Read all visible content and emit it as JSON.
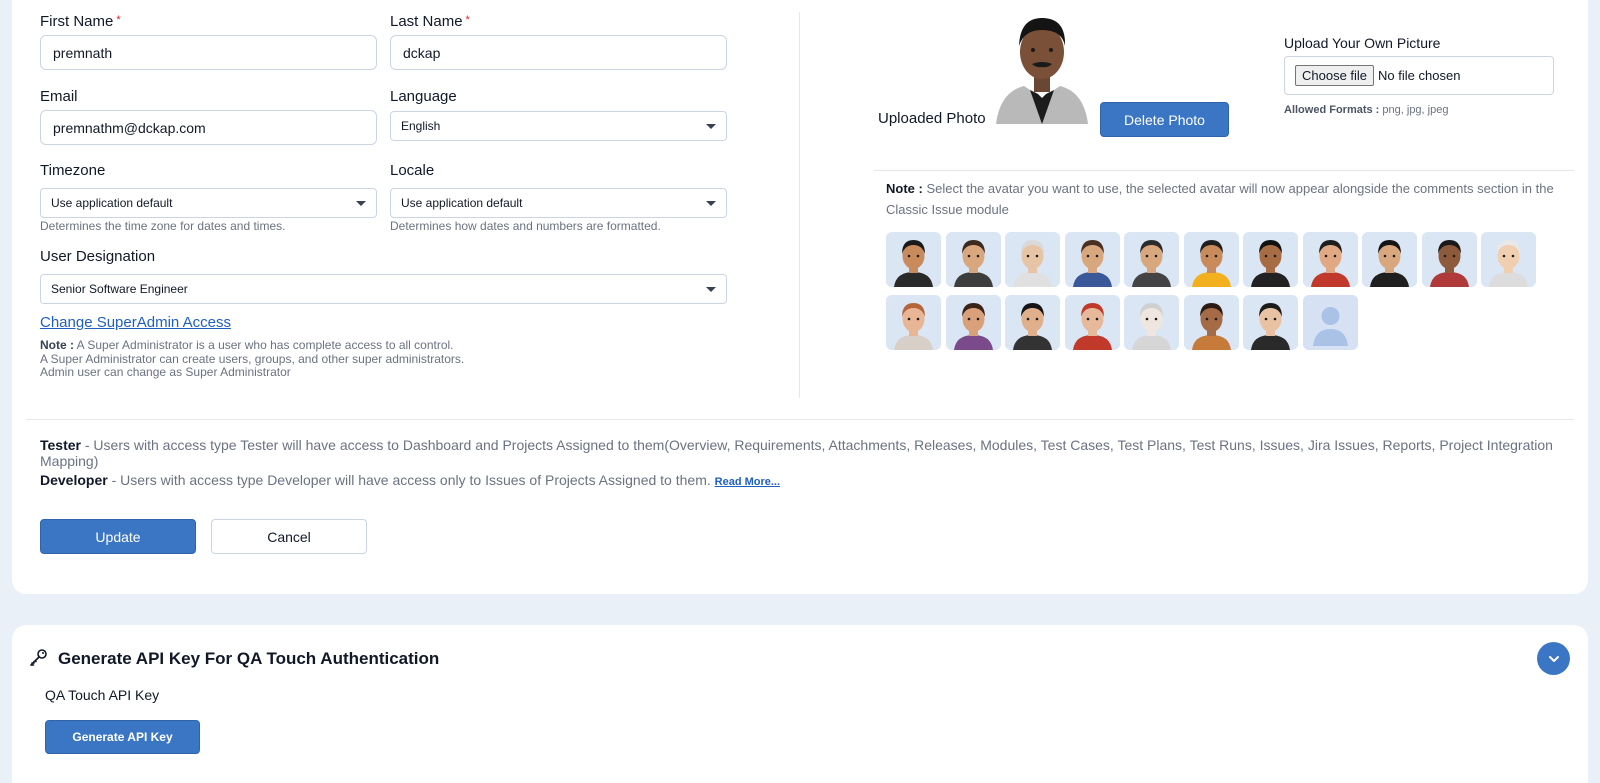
{
  "form": {
    "first_name": {
      "label": "First Name",
      "required": "*",
      "value": "premnath"
    },
    "last_name": {
      "label": "Last Name",
      "required": "*",
      "value": "dckap"
    },
    "email": {
      "label": "Email",
      "value": "premnathm@dckap.com"
    },
    "language": {
      "label": "Language",
      "value": "English"
    },
    "timezone": {
      "label": "Timezone",
      "value": "Use application default",
      "help": "Determines the time zone for dates and times."
    },
    "locale": {
      "label": "Locale",
      "value": "Use application default",
      "help": "Determines how dates and numbers are formatted."
    },
    "designation": {
      "label": "User Designation",
      "value": "Senior Software Engineer"
    }
  },
  "superadmin": {
    "link": "Change SuperAdmin Access",
    "note_label": "Note :",
    "note_lines": [
      "A Super Administrator is a user who has complete access to all control.",
      "A Super Administrator can create users, groups, and other super administrators.",
      "Admin user can change as Super Administrator"
    ]
  },
  "photo": {
    "uploaded_label": "Uploaded Photo",
    "delete_button": "Delete Photo",
    "upload_title": "Upload Your Own Picture",
    "choose_file": "Choose file",
    "no_file": "No file chosen",
    "formats_label": "Allowed Formats :",
    "formats": "png, jpg, jpeg"
  },
  "avatar_note": {
    "label": "Note :",
    "text": "Select the avatar you want to use, the selected avatar will now appear alongside the comments section in the",
    "text2": "Classic Issue module"
  },
  "avatars": [
    {
      "name": "avatar-1",
      "skin": "#c98b5c",
      "hair": "#1a1a1a",
      "shirt": "#2a2a2a"
    },
    {
      "name": "avatar-2",
      "skin": "#d9a77e",
      "hair": "#3b2a1e",
      "shirt": "#3d3d3d"
    },
    {
      "name": "avatar-3",
      "skin": "#e6c4a5",
      "hair": "#d9d9d9",
      "shirt": "#e0e0e0"
    },
    {
      "name": "avatar-4",
      "skin": "#d9a77e",
      "hair": "#4a3020",
      "shirt": "#3b5998"
    },
    {
      "name": "avatar-5",
      "skin": "#d9a77e",
      "hair": "#2b2b2b",
      "shirt": "#444444"
    },
    {
      "name": "avatar-6",
      "skin": "#c98b5c",
      "hair": "#1f1f1f",
      "shirt": "#f2b01e"
    },
    {
      "name": "avatar-7",
      "skin": "#a86c45",
      "hair": "#111111",
      "shirt": "#222222"
    },
    {
      "name": "avatar-8",
      "skin": "#e0a983",
      "hair": "#1e1e1e",
      "shirt": "#c0392b"
    },
    {
      "name": "avatar-9",
      "skin": "#d9a77e",
      "hair": "#151515",
      "shirt": "#1f1f1f"
    },
    {
      "name": "avatar-10",
      "skin": "#8d5a3b",
      "hair": "#1a1a1a",
      "shirt": "#b03a3a"
    },
    {
      "name": "avatar-11",
      "skin": "#f0cfb0",
      "hair": "#e8e8e8",
      "shirt": "#dcdcdc"
    },
    {
      "name": "avatar-12",
      "skin": "#e8b695",
      "hair": "#b5653a",
      "shirt": "#d8d0c8"
    },
    {
      "name": "avatar-13",
      "skin": "#d9a07a",
      "hair": "#3a2418",
      "shirt": "#7a4a8a"
    },
    {
      "name": "avatar-14",
      "skin": "#e0b08c",
      "hair": "#151515",
      "shirt": "#333333"
    },
    {
      "name": "avatar-15",
      "skin": "#e6b99a",
      "hair": "#c0392b",
      "shirt": "#c0392b"
    },
    {
      "name": "avatar-16",
      "skin": "#efe6e0",
      "hair": "#cfcfcf",
      "shirt": "#d6d6d6"
    },
    {
      "name": "avatar-17",
      "skin": "#a56a46",
      "hair": "#2a1a12",
      "shirt": "#c77b3b"
    },
    {
      "name": "avatar-18",
      "skin": "#e8c2a2",
      "hair": "#1b1b1b",
      "shirt": "#2a2a2a"
    },
    {
      "name": "avatar-19",
      "skin": "placeholder",
      "hair": "",
      "shirt": ""
    }
  ],
  "permissions": {
    "tester_label": "Tester",
    "tester_text": " - Users with access type Tester will have access to Dashboard and Projects Assigned to them(Overview, Requirements, Attachments, Releases, Modules, Test Cases, Test Plans, Test Runs, Issues, Jira Issues, Reports, Project Integration Mapping)",
    "developer_label": "Developer",
    "developer_text": " - Users with access type Developer will have access only to Issues of Projects Assigned to them.",
    "read_more": "Read More..."
  },
  "actions": {
    "update": "Update",
    "cancel": "Cancel"
  },
  "api": {
    "title": "Generate API Key For QA Touch Authentication",
    "key_label": "QA Touch API Key",
    "generate_button": "Generate API Key"
  },
  "colors": {
    "primary": "#3b76c4",
    "background": "#eaf0f8",
    "required": "#dc2626",
    "link": "#1f5fbf"
  }
}
